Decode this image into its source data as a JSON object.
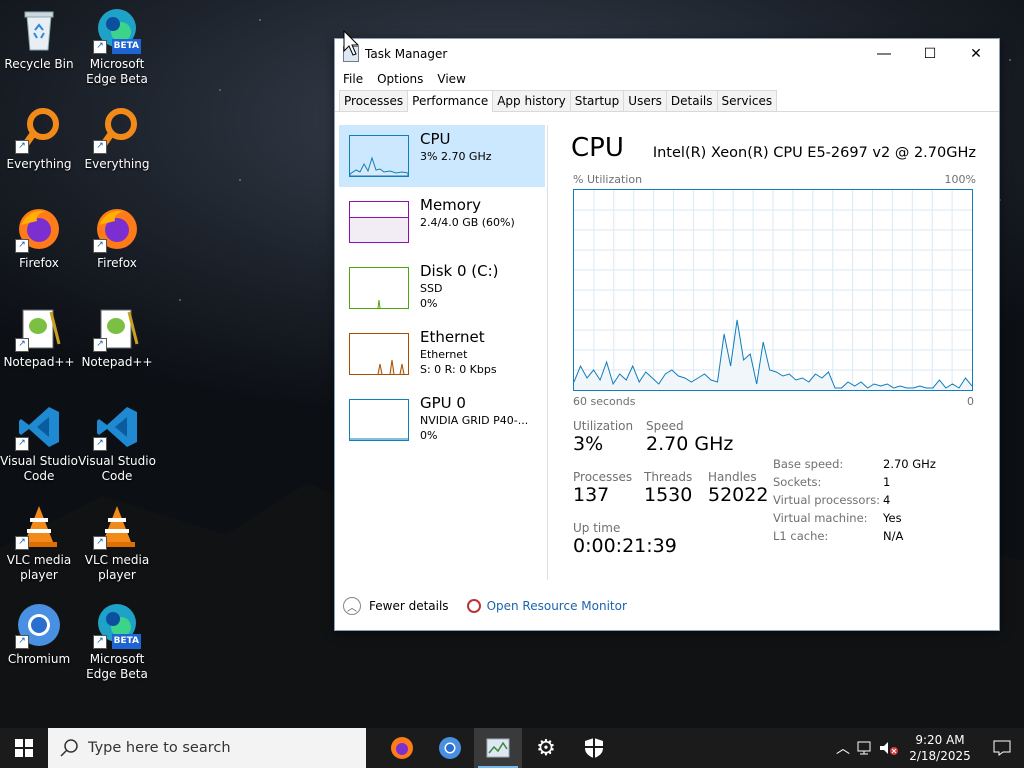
{
  "desktop": {
    "icons": [
      {
        "label": "Recycle Bin"
      },
      {
        "label": "Microsoft Edge Beta",
        "badge": "BETA"
      },
      {
        "label": "Everything"
      },
      {
        "label": "Everything"
      },
      {
        "label": "Firefox"
      },
      {
        "label": "Firefox"
      },
      {
        "label": "Notepad++"
      },
      {
        "label": "Notepad++"
      },
      {
        "label": "Visual Studio Code"
      },
      {
        "label": "Visual Studio Code"
      },
      {
        "label": "VLC media player"
      },
      {
        "label": "VLC media player"
      },
      {
        "label": "Chromium"
      },
      {
        "label": "Microsoft Edge Beta",
        "badge": "BETA"
      }
    ]
  },
  "taskmanager": {
    "title": "Task Manager",
    "menu": [
      "File",
      "Options",
      "View"
    ],
    "tabs": [
      "Processes",
      "Performance",
      "App history",
      "Startup",
      "Users",
      "Details",
      "Services"
    ],
    "active_tab": "Performance",
    "sidebar": [
      {
        "name": "CPU",
        "line1": "3%  2.70 GHz",
        "line2": "",
        "color": "#117dbb"
      },
      {
        "name": "Memory",
        "line1": "2.4/4.0 GB (60%)",
        "line2": "",
        "color": "#8b12ae"
      },
      {
        "name": "Disk 0 (C:)",
        "line1": "SSD",
        "line2": "0%",
        "color": "#4da60c"
      },
      {
        "name": "Ethernet",
        "line1": "Ethernet",
        "line2": "S: 0 R: 0 Kbps",
        "color": "#a74f01"
      },
      {
        "name": "GPU 0",
        "line1": "NVIDIA GRID P40-...",
        "line2": "0%",
        "color": "#117dbb"
      }
    ],
    "detail": {
      "title": "CPU",
      "model": "Intel(R) Xeon(R) CPU E5-2697 v2 @ 2.70GHz",
      "graph_top_left": "% Utilization",
      "graph_top_right": "100%",
      "graph_bottom_left": "60 seconds",
      "graph_bottom_right": "0",
      "stats": {
        "utilization_label": "Utilization",
        "utilization": "3%",
        "speed_label": "Speed",
        "speed": "2.70 GHz",
        "processes_label": "Processes",
        "processes": "137",
        "threads_label": "Threads",
        "threads": "1530",
        "handles_label": "Handles",
        "handles": "52022",
        "uptime_label": "Up time",
        "uptime": "0:00:21:39"
      },
      "specs": [
        {
          "k": "Base speed:",
          "v": "2.70 GHz"
        },
        {
          "k": "Sockets:",
          "v": "1"
        },
        {
          "k": "Virtual processors:",
          "v": "4"
        },
        {
          "k": "Virtual machine:",
          "v": "Yes"
        },
        {
          "k": "L1 cache:",
          "v": "N/A"
        }
      ]
    },
    "footer": {
      "fewer": "Fewer details",
      "monitor": "Open Resource Monitor"
    }
  },
  "chart_data": {
    "type": "area",
    "title": "",
    "xlabel": "60 seconds",
    "ylabel": "% Utilization",
    "ylim": [
      0,
      100
    ],
    "xlim": [
      60,
      0
    ],
    "values": [
      4,
      12,
      6,
      10,
      5,
      14,
      3,
      8,
      5,
      12,
      4,
      9,
      6,
      3,
      8,
      10,
      7,
      6,
      4,
      6,
      8,
      5,
      4,
      28,
      12,
      35,
      15,
      18,
      3,
      24,
      10,
      9,
      7,
      8,
      5,
      6,
      4,
      8,
      6,
      9,
      1,
      1,
      4,
      2,
      4,
      1,
      3,
      2,
      3,
      1,
      2,
      1,
      1,
      2,
      1,
      1,
      5,
      1,
      3,
      1,
      6,
      2
    ]
  },
  "taskbar": {
    "search_placeholder": "Type here to search",
    "time": "9:20 AM",
    "date": "2/18/2025"
  }
}
